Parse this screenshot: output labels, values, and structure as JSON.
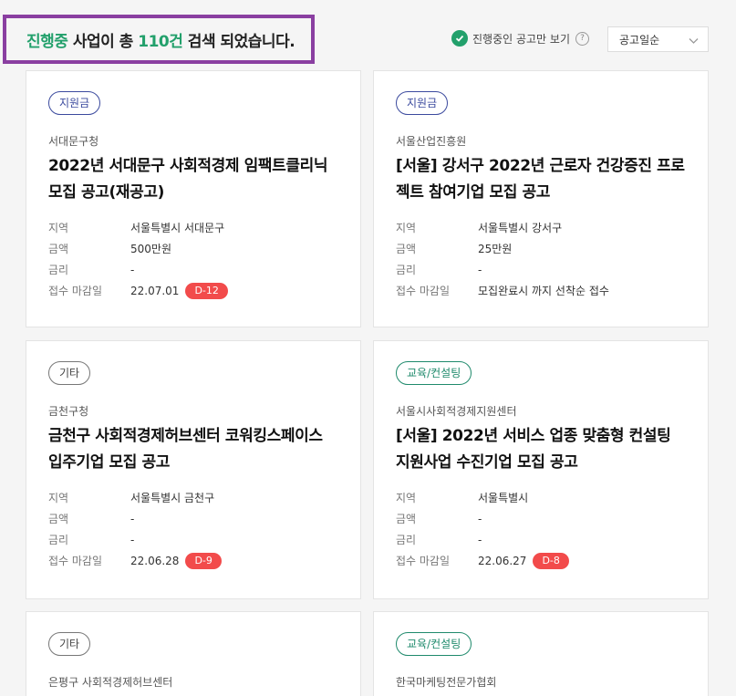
{
  "summary": {
    "prefix": "진행중",
    "mid": " 사업이 총 ",
    "count": "110건",
    "suffix": " 검색 되었습니다."
  },
  "filter": {
    "label": "진행중인 공고만 보기",
    "help": "?"
  },
  "sort": {
    "selected": "공고일순"
  },
  "colors": {
    "accent": "#22a06b",
    "dday": "#f24b4b",
    "highlight_border": "#8a3fa1"
  },
  "labels": {
    "region": "지역",
    "amount": "금액",
    "rate": "금리",
    "deadline": "접수 마감일"
  },
  "cards": [
    {
      "tag": "지원금",
      "tag_style": "blue",
      "org": "서대문구청",
      "title": "2022년 서대문구 사회적경제 임팩트클리닉 모집 공고(재공고)",
      "region": "서울특별시 서대문구",
      "amount": "500만원",
      "rate": "-",
      "deadline": "22.07.01",
      "dday": "D-12"
    },
    {
      "tag": "지원금",
      "tag_style": "blue",
      "org": "서울산업진흥원",
      "title": "[서울] 강서구 2022년 근로자 건강증진 프로젝트 참여기업 모집 공고",
      "region": "서울특별시 강서구",
      "amount": "25만원",
      "rate": "-",
      "deadline": "모집완료시 까지 선착순 접수",
      "dday": ""
    },
    {
      "tag": "기타",
      "tag_style": "gray",
      "org": "금천구청",
      "title": "금천구 사회적경제허브센터 코워킹스페이스 입주기업 모집 공고",
      "region": "서울특별시 금천구",
      "amount": "-",
      "rate": "-",
      "deadline": "22.06.28",
      "dday": "D-9"
    },
    {
      "tag": "교육/컨설팅",
      "tag_style": "teal",
      "org": "서울시사회적경제지원센터",
      "title": "[서울] 2022년 서비스 업종 맞춤형 컨설팅 지원사업 수진기업 모집 공고",
      "region": "서울특별시",
      "amount": "-",
      "rate": "-",
      "deadline": "22.06.27",
      "dday": "D-8"
    },
    {
      "tag": "기타",
      "tag_style": "gray",
      "org": "은평구 사회적경제허브센터"
    },
    {
      "tag": "교육/컨설팅",
      "tag_style": "teal",
      "org": "한국마케팅전문가협회"
    }
  ]
}
